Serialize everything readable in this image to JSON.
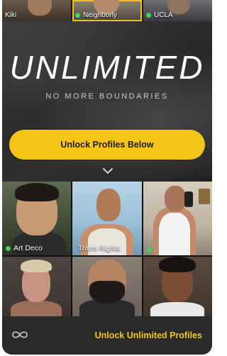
{
  "top_strip": {
    "profiles": [
      {
        "name": "Kiki",
        "online": false,
        "selected": false
      },
      {
        "name": "Neighborly",
        "online": true,
        "selected": true
      },
      {
        "name": "UCLA",
        "online": true,
        "selected": false
      }
    ]
  },
  "hero": {
    "title": "UNLIMITED",
    "subtitle": "NO MORE BOUNDARIES",
    "cta_label": "Unlock Profiles Below"
  },
  "grid": {
    "profiles": [
      {
        "name": "Art Deco",
        "online": true
      },
      {
        "name": "Trans Rights",
        "online": false
      },
      {
        "name": "",
        "online": true
      },
      {
        "name": "",
        "online": false
      },
      {
        "name": "",
        "online": false
      },
      {
        "name": "",
        "online": false
      }
    ]
  },
  "bottom_bar": {
    "icon": "infinity-icon",
    "link_label": "Unlock Unlimited Profiles"
  },
  "colors": {
    "accent": "#f4c518",
    "online": "#3bd65a",
    "background": "#1c1c1c"
  }
}
